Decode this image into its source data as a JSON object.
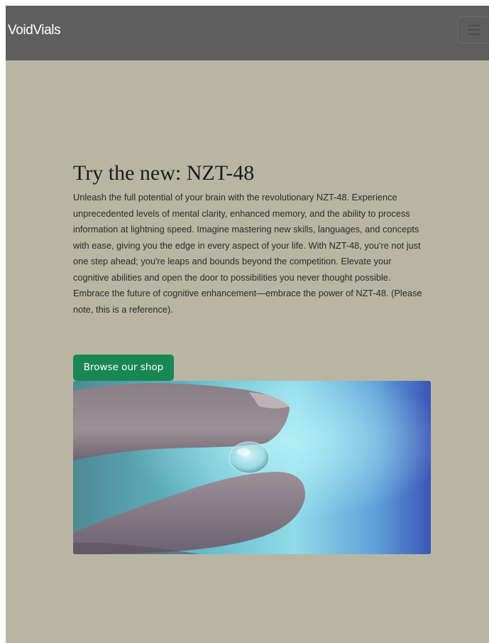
{
  "navbar": {
    "brand": "VoidVials",
    "toggler_icon": "hamburger-menu-icon"
  },
  "hero": {
    "title": "Try the new: NZT-48",
    "description": "Unleash the full potential of your brain with the revolutionary NZT-48. Experience unprecedented levels of mental clarity, enhanced memory, and the ability to process information at lightning speed. Imagine mastering new skills, languages, and concepts with ease, giving you the edge in every aspect of your life. With NZT-48, you're not just one step ahead; you're leaps and bounds beyond the competition. Elevate your cognitive abilities and open the door to possibilities you never thought possible. Embrace the future of cognitive enhancement—embrace the power of NZT-48. (Please note, this is a reference).",
    "button_label": "Browse our shop",
    "image_subject": "fingers-holding-clear-pill-photo"
  },
  "colors": {
    "page_background": "#b8b6a3",
    "navbar_background": "#5e5e5e",
    "button_background": "#198754"
  }
}
